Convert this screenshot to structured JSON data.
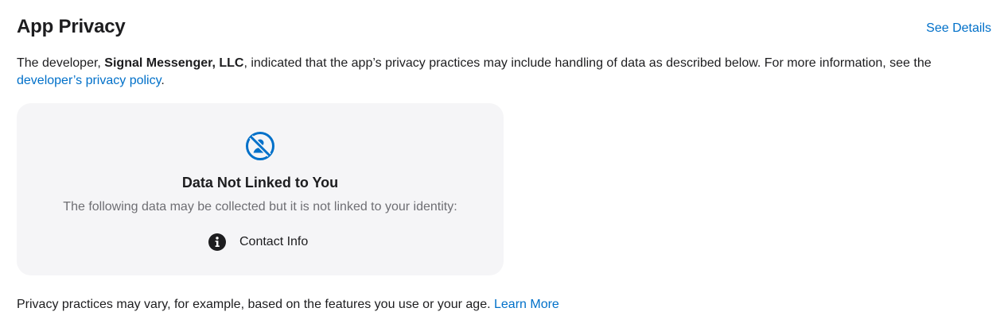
{
  "header": {
    "title": "App Privacy",
    "see_details": "See Details"
  },
  "description": {
    "prefix": "The developer, ",
    "developer_name": "Signal Messenger, LLC",
    "middle": ", indicated that the app’s privacy practices may include handling of data as described below. For more information, see the ",
    "policy_link": "developer’s privacy policy",
    "suffix": "."
  },
  "card": {
    "icon": "person-crossed-out-icon",
    "heading": "Data Not Linked to You",
    "subtitle": "The following data may be collected but it is not linked to your identity:",
    "items": [
      {
        "icon": "info-icon",
        "label": "Contact Info"
      }
    ]
  },
  "footer": {
    "text": "Privacy practices may vary, for example, based on the features you use or your age. ",
    "learn_more": "Learn More"
  },
  "colors": {
    "link": "#0070c9",
    "card_background": "#f5f5f7",
    "text": "#1d1d1f",
    "secondary_text": "#6e6e73"
  }
}
